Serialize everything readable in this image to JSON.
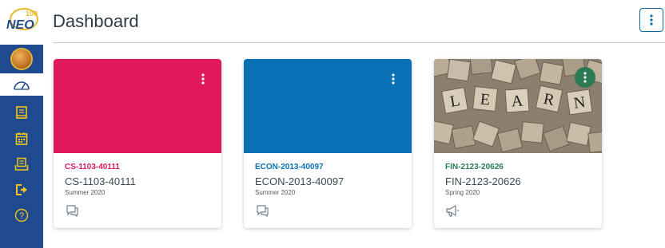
{
  "header": {
    "title": "Dashboard"
  },
  "sidebar": {
    "items": [
      {
        "icon": "avatar"
      },
      {
        "icon": "dashboard-icon",
        "active": true
      },
      {
        "icon": "courses-icon"
      },
      {
        "icon": "calendar-icon"
      },
      {
        "icon": "inbox-icon"
      },
      {
        "icon": "logout-icon"
      },
      {
        "icon": "help-icon"
      }
    ]
  },
  "cards": [
    {
      "code": "CS-1103-40111",
      "name": "CS-1103-40111",
      "term": "Summer 2020",
      "color": "#e0195a",
      "icon": "discussions-icon"
    },
    {
      "code": "ECON-2013-40097",
      "name": "ECON-2013-40097",
      "term": "Summer 2020",
      "color": "#0a70b5",
      "icon": "discussions-icon"
    },
    {
      "code": "FIN-2123-20626",
      "name": "FIN-2123-20626",
      "term": "Spring 2020",
      "color": "#2a7a54",
      "icon": "announcements-icon",
      "image_tiles": [
        "L",
        "E",
        "A",
        "R",
        "N"
      ]
    }
  ],
  "colors": {
    "sidebar": "#1f4a8f",
    "nav_icon": "#f5c518",
    "text": "#2d3b45"
  }
}
